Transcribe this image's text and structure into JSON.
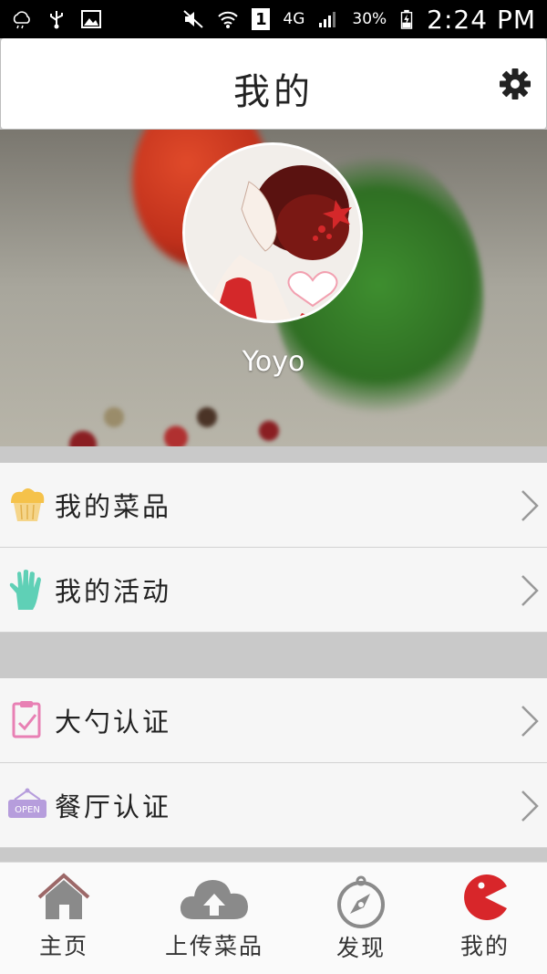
{
  "status_bar": {
    "battery_percent": "30%",
    "network": "4G",
    "sim": "1",
    "time": "2:24 PM"
  },
  "header": {
    "title": "我的"
  },
  "profile": {
    "username": "Yoyo"
  },
  "menu": {
    "group1": [
      {
        "label": "我的菜品",
        "icon": "cupcake-icon"
      },
      {
        "label": "我的活动",
        "icon": "hand-icon"
      }
    ],
    "group2": [
      {
        "label": "大勺认证",
        "icon": "clipboard-check-icon"
      },
      {
        "label": "餐厅认证",
        "icon": "open-sign-icon",
        "icon_text": "OPEN"
      }
    ]
  },
  "tabbar": {
    "items": [
      {
        "label": "主页",
        "icon": "home-icon"
      },
      {
        "label": "上传菜品",
        "icon": "cloud-upload-icon"
      },
      {
        "label": "发现",
        "icon": "compass-icon"
      },
      {
        "label": "我的",
        "icon": "pacman-icon",
        "active": true
      }
    ]
  },
  "colors": {
    "accent_red": "#d8262a",
    "tab_icon_gray": "#8a8a8a",
    "cupcake_yellow": "#f5c24a",
    "hand_teal": "#5fd0b6",
    "clipboard_pink": "#e880b4",
    "open_purple": "#b69ddc"
  }
}
